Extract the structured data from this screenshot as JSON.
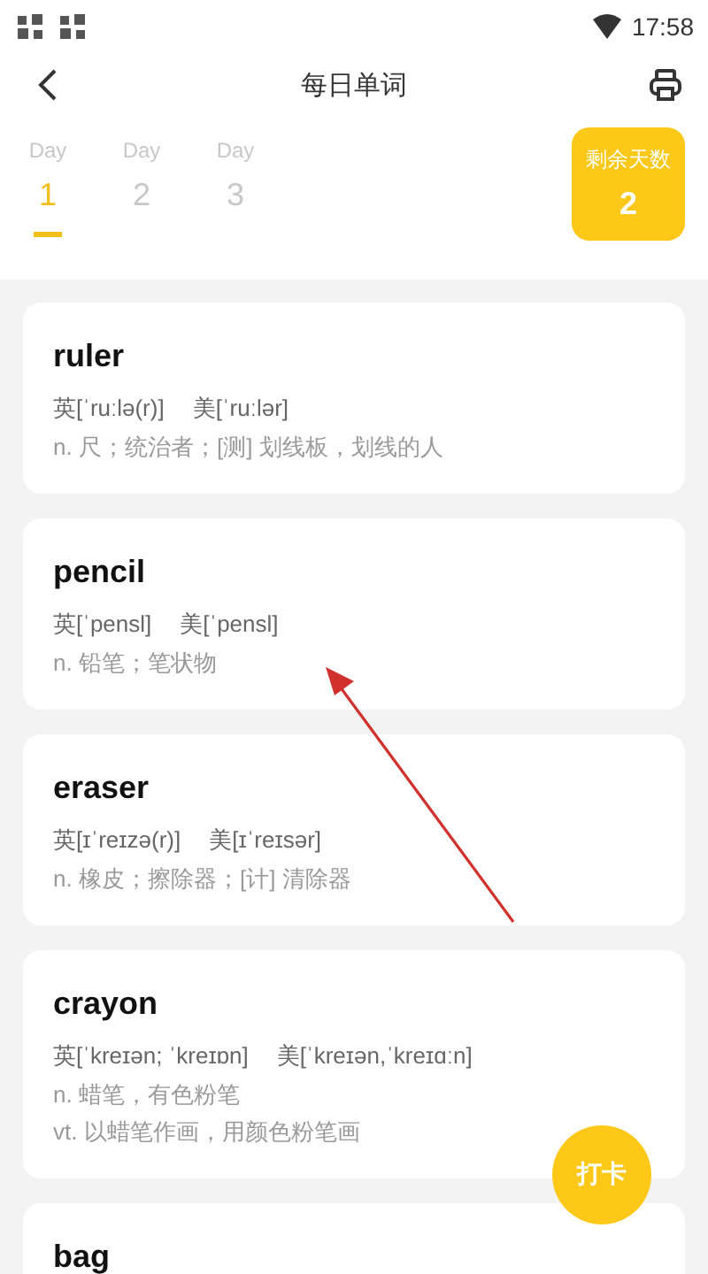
{
  "status_bar": {
    "time": "17:58"
  },
  "header": {
    "title": "每日单词"
  },
  "day_tabs": [
    {
      "label": "Day",
      "number": "1",
      "selected": true
    },
    {
      "label": "Day",
      "number": "2",
      "selected": false
    },
    {
      "label": "Day",
      "number": "3",
      "selected": false
    }
  ],
  "remaining": {
    "label": "剩余天数",
    "value": "2"
  },
  "words": [
    {
      "word": "ruler",
      "uk_label": "英",
      "uk": "[ˈruːlə(r)]",
      "us_label": "美",
      "us": "[ˈruːlər]",
      "meanings": [
        "n. 尺；统治者；[测] 划线板，划线的人"
      ]
    },
    {
      "word": "pencil",
      "uk_label": "英",
      "uk": "[ˈpensl]",
      "us_label": "美",
      "us": "[ˈpensl]",
      "meanings": [
        "n. 铅笔；笔状物"
      ]
    },
    {
      "word": "eraser",
      "uk_label": "英",
      "uk": "[ɪˈreɪzə(r)]",
      "us_label": "美",
      "us": "[ɪˈreɪsər]",
      "meanings": [
        "n. 橡皮；擦除器；[计] 清除器"
      ]
    },
    {
      "word": "crayon",
      "uk_label": "英",
      "uk": "[ˈkreɪən; ˈkreɪɒn]",
      "us_label": "美",
      "us": "[ˈkreɪən,ˈkreɪɑːn]",
      "meanings": [
        "n. 蜡笔，有色粉笔",
        "vt. 以蜡笔作画，用颜色粉笔画"
      ]
    },
    {
      "word": "bag"
    }
  ],
  "checkin_button": {
    "label": "打卡"
  }
}
